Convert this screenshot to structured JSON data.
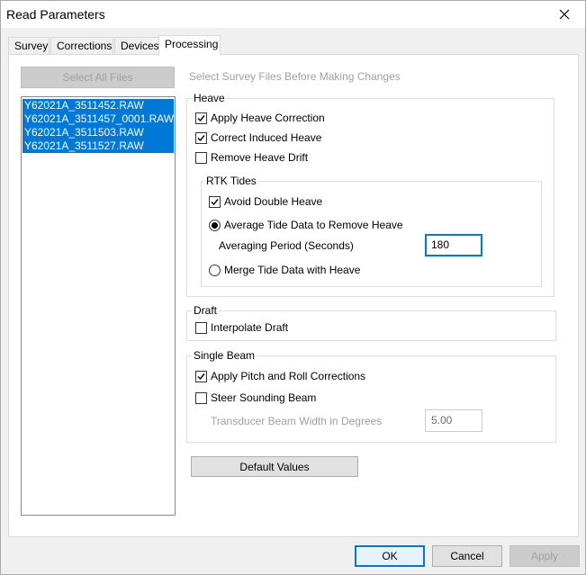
{
  "window": {
    "title": "Read Parameters"
  },
  "tabs": [
    {
      "label": "Survey",
      "active": false
    },
    {
      "label": "Corrections",
      "active": false
    },
    {
      "label": "Devices",
      "active": false
    },
    {
      "label": "Processing",
      "active": true
    }
  ],
  "select_all_label": "Select All Files",
  "hint": "Select Survey Files Before Making Changes",
  "files": [
    "Y62021A_3511452.RAW",
    "Y62021A_3511457_0001.RAW",
    "Y62021A_3511503.RAW",
    "Y62021A_3511527.RAW"
  ],
  "heave": {
    "label": "Heave",
    "apply_heave_correction": {
      "label": "Apply Heave Correction",
      "checked": true
    },
    "correct_induced_heave": {
      "label": "Correct Induced Heave",
      "checked": true
    },
    "remove_heave_drift": {
      "label": "Remove Heave Drift",
      "checked": false
    },
    "rtk": {
      "label": "RTK Tides",
      "avoid_double_heave": {
        "label": "Avoid Double Heave",
        "checked": true
      },
      "average_tide": {
        "label": "Average Tide Data to Remove Heave",
        "selected": true
      },
      "averaging_period_label": "Averaging Period (Seconds)",
      "averaging_period_value": "180",
      "merge_tide": {
        "label": "Merge Tide Data with Heave",
        "selected": false
      }
    }
  },
  "draft": {
    "label": "Draft",
    "interpolate_draft": {
      "label": "Interpolate Draft",
      "checked": false
    }
  },
  "single_beam": {
    "label": "Single Beam",
    "apply_pitch_roll": {
      "label": "Apply Pitch and Roll Corrections",
      "checked": true
    },
    "steer_sounding_beam": {
      "label": "Steer Sounding Beam",
      "checked": false
    },
    "beam_width_label": "Transducer Beam Width in Degrees",
    "beam_width_value": "5.00"
  },
  "default_values_label": "Default Values",
  "footer": {
    "ok": "OK",
    "cancel": "Cancel",
    "apply": "Apply"
  }
}
